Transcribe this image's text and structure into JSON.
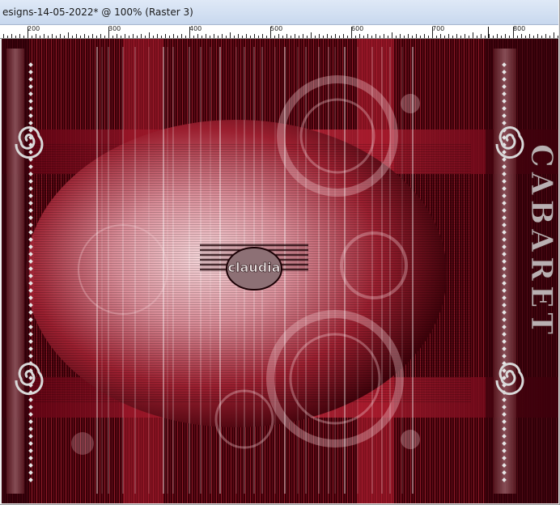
{
  "window": {
    "title": "esigns-14-05-2022* @ 100% (Raster 3)"
  },
  "ruler": {
    "labels": [
      "200",
      "300",
      "400",
      "500",
      "600",
      "700",
      "800"
    ]
  },
  "canvas": {
    "watermark_text": "claudia",
    "side_text": "CABARET",
    "colors": {
      "background_dark": "#1b0005",
      "crimson": "#8e0e1c",
      "pink_glow": "#f3c5cb",
      "silver": "#c8c8c8"
    }
  }
}
